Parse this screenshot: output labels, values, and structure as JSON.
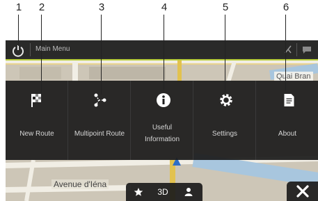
{
  "callouts": [
    "1",
    "2",
    "3",
    "4",
    "5",
    "6"
  ],
  "title_bar": {
    "title": "Main Menu"
  },
  "map": {
    "street_labels": [
      "Quai Bran",
      "Avenue d'Iéna"
    ]
  },
  "menu": {
    "items": [
      {
        "id": "new-route",
        "icon": "checkered-flag-icon",
        "label": "New Route"
      },
      {
        "id": "multipoint-route",
        "icon": "multipoint-route-icon",
        "label": "Multipoint Route"
      },
      {
        "id": "useful-information",
        "icon": "info-icon",
        "label_line1": "Useful",
        "label_line2": "Information"
      },
      {
        "id": "settings",
        "icon": "gear-icon",
        "label": "Settings"
      },
      {
        "id": "about",
        "icon": "document-icon",
        "label": "About"
      }
    ]
  },
  "bottom_bar": {
    "favorites_icon": "star-icon",
    "view_mode": "3D",
    "user_icon": "user-icon"
  },
  "close_icon": "close-icon"
}
